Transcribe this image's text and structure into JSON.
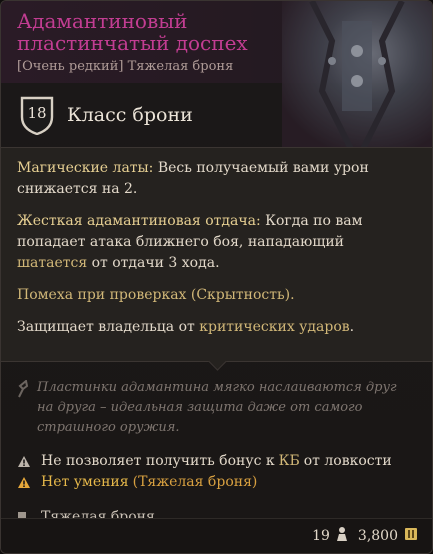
{
  "item": {
    "title": "Адамантиновый пластинчатый доспех",
    "subtitle": "[Очень редкий] Тяжелая броня"
  },
  "armor_class": {
    "value": "18",
    "label": "Класс брони"
  },
  "description": {
    "p1_key": "Магические латы:",
    "p1_text": " Весь получаемый вами урон снижается на 2.",
    "p2_key": "Жесткая адамантиновая отдача:",
    "p2_text_a": " Когда по вам попадает атака ближнего боя, нападающий ",
    "p2_link": "шатается",
    "p2_text_b": " от отдачи 3 хода.",
    "p3_a": "Помеха",
    "p3_b": " при ",
    "p3_c": "проверках",
    "p3_d": " (Скрытность).",
    "p4_a": "Защищает владельца от ",
    "p4_link": "критических ударов",
    "p4_b": "."
  },
  "lore": "Пластинки адамантина мягко наслаиваются друг на друга – идеальная защита даже от самого страшного оружия.",
  "notes": {
    "dex_a": "Не позволяет получить бонус к ",
    "dex_link": "КБ",
    "dex_b": " от ловкости",
    "prof_a": "Нет умения",
    "prof_b": " (Тяжелая броня)"
  },
  "category": "Тяжелая броня",
  "footer": {
    "weight": "19",
    "price": "3,800"
  },
  "colors": {
    "title": "#c23d92",
    "keyword": "#e6cf92",
    "warning": "#e6b84a"
  },
  "icons": [
    "shield-icon",
    "quill-icon",
    "warning-icon",
    "heavy-armor-icon",
    "weight-icon",
    "gold-icon"
  ]
}
